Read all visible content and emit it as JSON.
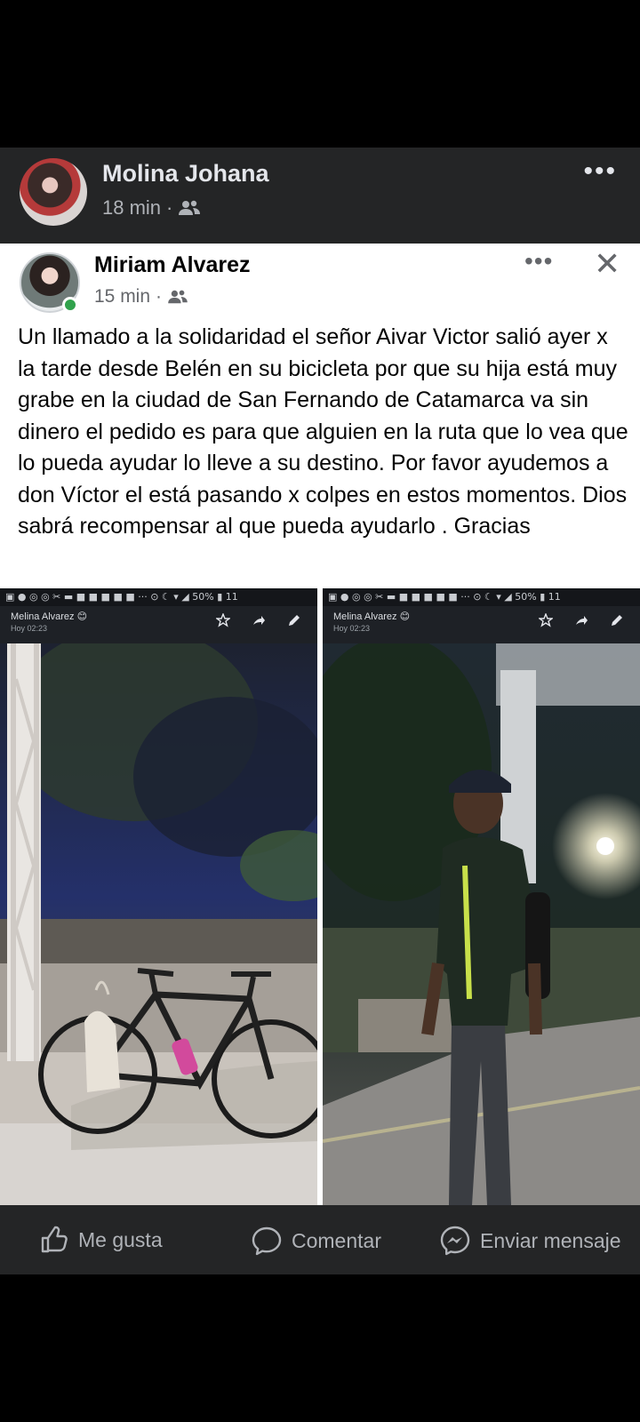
{
  "outer_post": {
    "author": "Molina Johana",
    "time": "18 min",
    "separator": "·",
    "audience_icon": "friends-icon",
    "more_label": "•••"
  },
  "shared_post": {
    "author": "Miriam Alvarez",
    "time": "15 min",
    "separator": "·",
    "audience_icon": "friends-icon",
    "more_label": "•••",
    "close_label": "✕",
    "text": "Un llamado a la solidaridad el señor Aivar Victor salió ayer x la tarde desde Belén en su bicicleta por que su hija está muy grabe en la ciudad de San Fernando de Catamarca va sin dinero el pedido es para que alguien en la ruta que lo vea que lo pueda ayudar lo lleve a su destino. Por favor ayudemos a don Víctor el está pasando x colpes en estos momentos. Dios sabrá recompensar al que pueda ayudarlo . Gracias"
  },
  "photos": [
    {
      "status": "▣ ● ◎ ◎ ✂ ▬ ■ ■ ■ ■ ■ ··· ⊙ ☾ ▾ ◢ 50% ▮ 11",
      "viewer_name": "Melina Alvarez 😊",
      "viewer_time": "Hoy 02:23"
    },
    {
      "status": "▣ ● ◎ ◎ ✂ ▬ ■ ■ ■ ■ ■ ··· ⊙ ☾ ▾ ◢ 50% ▮ 11",
      "viewer_name": "Melina Alvarez 😊",
      "viewer_time": "Hoy 02:23"
    }
  ],
  "actions": {
    "like": "Me gusta",
    "comment": "Comentar",
    "send": "Enviar mensaje"
  },
  "colors": {
    "dark_bg": "#242526",
    "light_bg": "#ffffff",
    "online": "#31a24c"
  }
}
